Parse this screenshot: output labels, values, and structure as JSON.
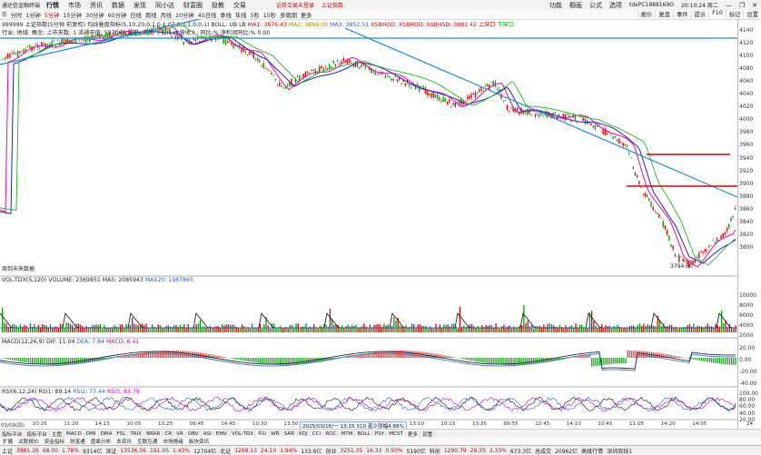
{
  "menubar": {
    "app_title": "通达信金融终端",
    "items": [
      "行情",
      "市场",
      "资讯",
      "数据",
      "发现",
      "同小达",
      "财富圈",
      "投教",
      "交易"
    ],
    "active_index": 0,
    "alert1": "证券交易未登录",
    "alert2": "上证指数",
    "right_items": [
      "功能",
      "橱画",
      "公式",
      "选项"
    ],
    "account": "tdxPC1888169O",
    "clock": "20:10:24 周二",
    "window_controls": [
      "—",
      "❐",
      "✕"
    ]
  },
  "periodbar": {
    "items": [
      "☰",
      "分时",
      "1分钟",
      "5分钟",
      "15分钟",
      "30分钟",
      "60分钟",
      "日线",
      "周线",
      "月线",
      "10分钟",
      "45日线",
      "季线",
      "年线",
      "5秒",
      "15秒",
      "多周期",
      "更多"
    ],
    "selected_index": 3,
    "right_items": [
      "报价",
      "复盘",
      "事件",
      "提示",
      "F10",
      "标记",
      "设置"
    ]
  },
  "price_pane": {
    "title_line": "999999 上证指数(5分钟 前复权)",
    "ma_line": [
      {
        "text": "均线叠盘指标(5,10,20,0,1,0,1,07,0,0,1,0,0,1) BOLL:",
        "color": "#333333"
      },
      {
        "text": "UB",
        "color": "#333333"
      },
      {
        "text": "LB",
        "color": "#333333"
      },
      {
        "text": "MA1: 3876.43",
        "color": "#d00000"
      },
      {
        "text": "MA2: 3869.00",
        "color": "#b08000"
      },
      {
        "text": "MA3: 3852.51",
        "color": "#2060d0"
      },
      {
        "text": "XSBHOD: XSBHDD: XSBHSD:",
        "color": "#d00000"
      },
      {
        "text": "3881.42",
        "color": "#d00000"
      },
      {
        "text": "上穿口",
        "color": "#d00000"
      },
      {
        "text": "下穿口",
        "color": "#00a000"
      }
    ],
    "info_line": "行业: 地域: 概念: 上市天数: 1 流通市值: 587063 股东: 平均 十股:1 主营收入: 同比:% 净利润同比:% 0.00",
    "low_label": "3794.60",
    "nearby_label": "周到未来数据",
    "y_ticks": [
      "4140",
      "4120",
      "4100",
      "4080",
      "4060",
      "4040",
      "4020",
      "4000",
      "3980",
      "3960",
      "3940",
      "3920",
      "3900",
      "3880",
      "3860",
      "3840",
      "3820",
      "3800"
    ]
  },
  "volume_pane": {
    "header": "VOL-TDX(5,120) VOLUME: 2369851",
    "ma5": "MA5: 2085943",
    "ma120": "MA120: 1987865",
    "y_ticks": [
      "10000",
      "8000",
      "6000",
      "4000",
      "2000"
    ]
  },
  "macd_pane": {
    "header": "MACD(12,26,9)",
    "dif": "DIF: 11.04",
    "dea": "DEA: 7.84",
    "macd": "MACD: 6.41",
    "y_ticks": [
      "20.00",
      "0.00",
      "-20.00",
      "-40.00"
    ]
  },
  "rsi_pane": {
    "header": "RSI(6,12,24)",
    "rsi1": "RSI1: 89.14",
    "rsi2": "RSI2: 77.44",
    "rsi3": "RSI3: 83.79",
    "y_ticks": [
      "100.00",
      "80.00",
      "60.00",
      "40.00",
      "20.00"
    ]
  },
  "time_axis": {
    "labels": [
      "03/09(四)",
      "10:25",
      "11:20",
      "14:15",
      "10:05",
      "13:25",
      "09:45",
      "14:45",
      "10:30",
      "13:50",
      "14:35",
      "10:55",
      "14:00",
      "13:10",
      "10:15",
      "13:35",
      "09:55",
      "13:45",
      "14:10",
      "10:45",
      "11:05",
      "14:20",
      "14:05"
    ],
    "tooltip": "2025/03/16/一 13:15 310 富少涨幅4.86%",
    "right_label": "24"
  },
  "tabbar": {
    "items": [
      "指标平台",
      "指标平台",
      "主图",
      "MACD",
      "DMI",
      "DMA",
      "FSL",
      "TRIX",
      "BRAR",
      "CR",
      "VR",
      "OBV",
      "ASI",
      "EMV",
      "VOL-TDX",
      "RSI",
      "WR",
      "SAR",
      "KDJ",
      "CCI",
      "ROC",
      "MTM",
      "BOLL",
      "PSY",
      "MCST",
      "更多",
      "设置"
    ],
    "active_index": 15
  },
  "subtabs": [
    "扩展",
    "关联报价",
    "资金指标",
    "财富通",
    "盘面分析",
    "本资讯",
    "互联互通",
    "市场情绪",
    "板块资讯"
  ],
  "statusbar": [
    {
      "text": "上证",
      "color": "#222222"
    },
    {
      "text": "3881.26",
      "color": "#d00000"
    },
    {
      "text": "68.00",
      "color": "#d00000"
    },
    {
      "text": "1.78%",
      "color": "#d00000"
    },
    {
      "text": "9314亿",
      "color": "#222222"
    },
    {
      "text": "深证",
      "color": "#222222"
    },
    {
      "text": "13536.56",
      "color": "#d00000"
    },
    {
      "text": "191.05",
      "color": "#d00000"
    },
    {
      "text": "1.43%",
      "color": "#d00000"
    },
    {
      "text": "12704亿",
      "color": "#222222"
    },
    {
      "text": "北证",
      "color": "#222222"
    },
    {
      "text": "1268.13",
      "color": "#d00000"
    },
    {
      "text": "24.10",
      "color": "#d00000"
    },
    {
      "text": "1.94%",
      "color": "#d00000"
    },
    {
      "text": "133.6亿",
      "color": "#222222"
    },
    {
      "text": "创业",
      "color": "#222222"
    },
    {
      "text": "3251.35",
      "color": "#d00000"
    },
    {
      "text": "16.33",
      "color": "#d00000"
    },
    {
      "text": "0.50%",
      "color": "#d00000"
    },
    {
      "text": "5190亿",
      "color": "#222222"
    },
    {
      "text": "科创",
      "color": "#222222"
    },
    {
      "text": "1290.79",
      "color": "#d00000"
    },
    {
      "text": "29.35",
      "color": "#d00000"
    },
    {
      "text": "2.33%",
      "color": "#d00000"
    },
    {
      "text": "673.3亿",
      "color": "#222222"
    },
    {
      "text": "总成交",
      "color": "#222222"
    },
    {
      "text": "20962亿",
      "color": "#222222"
    },
    {
      "text": "高级行情",
      "color": "#222222"
    },
    {
      "text": "深圳双线1",
      "color": "#222222"
    }
  ]
}
